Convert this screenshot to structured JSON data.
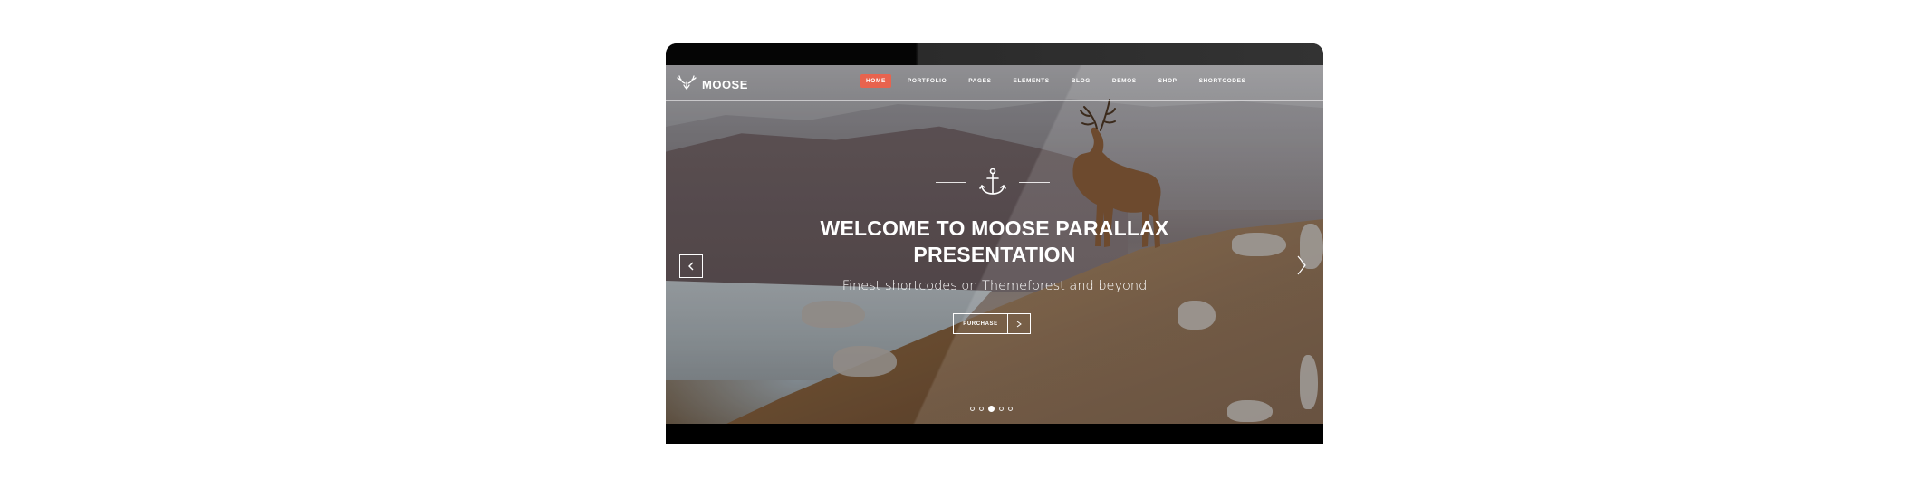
{
  "brand": {
    "name": "MOOSE",
    "logo_icon": "deer-antler-icon"
  },
  "nav": {
    "items": [
      {
        "label": "HOME",
        "active": true
      },
      {
        "label": "PORTFOLIO",
        "active": false
      },
      {
        "label": "PAGES",
        "active": false
      },
      {
        "label": "ELEMENTS",
        "active": false
      },
      {
        "label": "BLOG",
        "active": false
      },
      {
        "label": "DEMOS",
        "active": false
      },
      {
        "label": "SHOP",
        "active": false
      },
      {
        "label": "SHORTCODES",
        "active": false
      }
    ],
    "active_color": "#e8634e"
  },
  "hero": {
    "icon": "anchor-icon",
    "title_line1": "WELCOME TO MOOSE PARALLAX",
    "title_line2": "PRESENTATION",
    "subtitle": "Finest shortcodes on Themeforest and beyond",
    "cta_label": "PURCHASE",
    "cta_icon": "arrow-right-icon"
  },
  "slider": {
    "prev_icon": "chevron-left-icon",
    "next_icon": "chevron-right-icon",
    "dots_count": 5,
    "active_dot_index": 2
  },
  "colors": {
    "text": "#ffffff",
    "device_frame": "#0a0a0a"
  }
}
